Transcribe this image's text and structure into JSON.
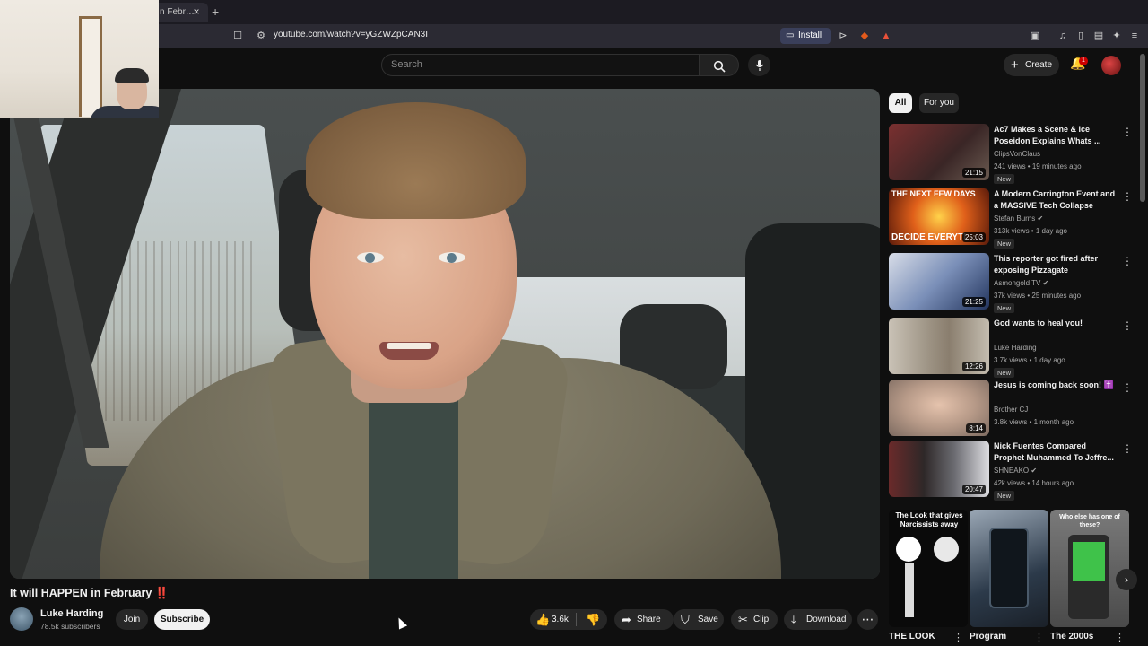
{
  "browser": {
    "tab_title": "n Febr…",
    "tab_close": "×",
    "new_tab": "+",
    "url": "youtube.com/watch?v=yGZWZpCAN3I",
    "install_label": "Install"
  },
  "header": {
    "search_placeholder": "Search",
    "create_label": "Create",
    "notification_count": "1"
  },
  "video": {
    "title": "It will HAPPEN in February ‼️",
    "channel_name": "Luke Harding",
    "subscribers": "78.5k subscribers",
    "join_label": "Join",
    "subscribe_label": "Subscribe",
    "like_count": "3.6k",
    "share_label": "Share",
    "save_label": "Save",
    "clip_label": "Clip",
    "download_label": "Download"
  },
  "sidebar": {
    "chips": [
      "All",
      "For you"
    ],
    "recommendations": [
      {
        "title": "Ac7 Makes a Scene & Ice Poseidon Explains Whats ...",
        "channel": "ClipsVonClaus",
        "meta": "241 views • 19 minutes ago",
        "badge": "New",
        "duration": "21:15",
        "verified": false,
        "thumb_color": "#5a3a3a"
      },
      {
        "title": "A Modern Carrington Event and a MASSIVE Tech Collapse Cou...",
        "channel": "Stefan Burns",
        "meta": "313k views • 1 day ago",
        "badge": "New",
        "duration": "25:03",
        "verified": true,
        "thumb_color": "#c0501e",
        "thumb_text_top": "THE NEXT FEW DAYS",
        "thumb_text_bottom": "DECIDE EVERYTI"
      },
      {
        "title": "This reporter got fired after exposing Pizzagate",
        "channel": "Asmongold TV",
        "meta": "37k views • 25 minutes ago",
        "badge": "New",
        "duration": "21:25",
        "verified": true,
        "thumb_color": "#3c5a8c"
      },
      {
        "title": "God wants to heal you!",
        "channel": "Luke Harding",
        "meta": "3.7k views • 1 day ago",
        "badge": "New",
        "duration": "12:26",
        "verified": false,
        "thumb_color": "#a49a8a"
      },
      {
        "title": "Jesus is coming back soon! ✝️",
        "channel": "Brother CJ",
        "meta": "3.8k views • 1 month ago",
        "badge": "",
        "duration": "8:14",
        "verified": false,
        "thumb_color": "#b79a88"
      },
      {
        "title": "Nick Fuentes Compared Prophet Muhammed To Jeffre...",
        "channel": "SHNEAKO",
        "meta": "42k views • 14 hours ago",
        "badge": "New",
        "duration": "20:47",
        "verified": true,
        "thumb_color": "#4a4040"
      }
    ],
    "shorts": [
      {
        "title": "THE LOOK",
        "thumb_caption": "The Look that gives Narcissists away",
        "thumb_color": "#111111"
      },
      {
        "title": "Program",
        "thumb_color": "#3a4a5a"
      },
      {
        "title": "The 2000s",
        "thumb_caption": "Who else has one of these?",
        "thumb_color": "#6a6a6a"
      }
    ]
  },
  "colors": {
    "background": "#0f0f0f",
    "accent_red": "#cc0000",
    "chip_active": "#f1f1f1"
  }
}
